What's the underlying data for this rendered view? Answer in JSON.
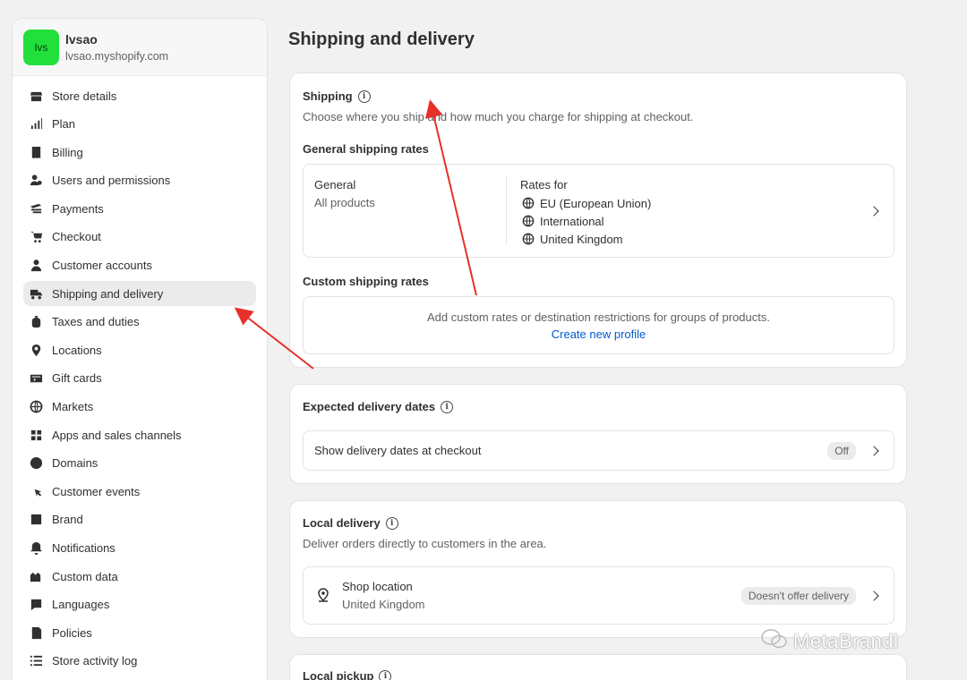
{
  "store": {
    "avatar_text": "lvs",
    "name": "lvsao",
    "domain": "lvsao.myshopify.com",
    "avatar_color": "#22e03c"
  },
  "sidebar": {
    "items": [
      {
        "label": "Store details",
        "icon": "store-icon"
      },
      {
        "label": "Plan",
        "icon": "plan-chart-icon"
      },
      {
        "label": "Billing",
        "icon": "billing-receipt-icon"
      },
      {
        "label": "Users and permissions",
        "icon": "users-icon"
      },
      {
        "label": "Payments",
        "icon": "payments-icon"
      },
      {
        "label": "Checkout",
        "icon": "cart-icon"
      },
      {
        "label": "Customer accounts",
        "icon": "person-icon"
      },
      {
        "label": "Shipping and delivery",
        "icon": "truck-icon",
        "active": true
      },
      {
        "label": "Taxes and duties",
        "icon": "tax-icon"
      },
      {
        "label": "Locations",
        "icon": "location-pin-icon"
      },
      {
        "label": "Gift cards",
        "icon": "gift-card-icon"
      },
      {
        "label": "Markets",
        "icon": "markets-globe-icon"
      },
      {
        "label": "Apps and sales channels",
        "icon": "apps-grid-icon"
      },
      {
        "label": "Domains",
        "icon": "domains-globe-icon"
      },
      {
        "label": "Customer events",
        "icon": "cursor-click-icon"
      },
      {
        "label": "Brand",
        "icon": "brand-icon"
      },
      {
        "label": "Notifications",
        "icon": "bell-icon"
      },
      {
        "label": "Custom data",
        "icon": "custom-data-icon"
      },
      {
        "label": "Languages",
        "icon": "language-icon"
      },
      {
        "label": "Policies",
        "icon": "policies-icon"
      },
      {
        "label": "Store activity log",
        "icon": "list-icon"
      }
    ]
  },
  "page": {
    "title": "Shipping and delivery"
  },
  "shipping": {
    "title": "Shipping",
    "description": "Choose where you ship and how much you charge for shipping at checkout.",
    "general_rates_title": "General shipping rates",
    "general": {
      "name": "General",
      "scope": "All products",
      "rates_for_label": "Rates for",
      "regions": [
        "EU (European Union)",
        "International",
        "United Kingdom"
      ]
    },
    "custom_rates_title": "Custom shipping rates",
    "custom_rates_text": "Add custom rates or destination restrictions for groups of products.",
    "create_profile_link": "Create new profile"
  },
  "expected_delivery": {
    "title": "Expected delivery dates",
    "row_label": "Show delivery dates at checkout",
    "status": "Off"
  },
  "local_delivery": {
    "title": "Local delivery",
    "description": "Deliver orders directly to customers in the area.",
    "location_name": "Shop location",
    "location_country": "United Kingdom",
    "status": "Doesn't offer delivery"
  },
  "local_pickup": {
    "title": "Local pickup"
  },
  "watermark": {
    "text": "MetaBrandl"
  },
  "colors": {
    "link": "#005bd3",
    "annotation_arrow": "#e8302a",
    "active_nav": "#ebebeb"
  }
}
